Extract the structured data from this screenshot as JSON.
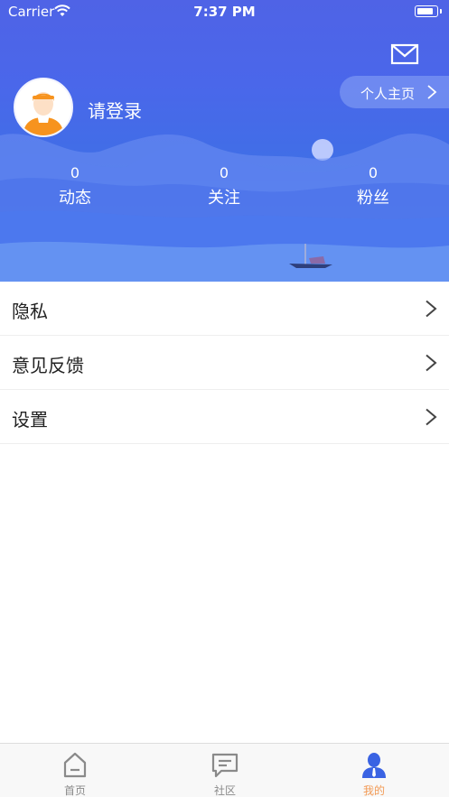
{
  "status_bar": {
    "carrier": "Carrier",
    "time": "7:37 PM"
  },
  "header": {
    "login_text": "请登录",
    "profile_link": "个人主页",
    "stats": [
      {
        "value": "0",
        "label": "动态"
      },
      {
        "value": "0",
        "label": "关注"
      },
      {
        "value": "0",
        "label": "粉丝"
      }
    ]
  },
  "menu": [
    {
      "label": "隐私"
    },
    {
      "label": "意见反馈"
    },
    {
      "label": "设置"
    }
  ],
  "tabbar": {
    "tabs": [
      {
        "label": "首页",
        "icon": "home-icon"
      },
      {
        "label": "社区",
        "icon": "chat-icon"
      },
      {
        "label": "我的",
        "icon": "person-icon"
      }
    ],
    "active_index": 2
  },
  "colors": {
    "header_blue": "#4a67ea",
    "active_tab": "#f29a55",
    "avatar_orange": "#f7931e"
  }
}
